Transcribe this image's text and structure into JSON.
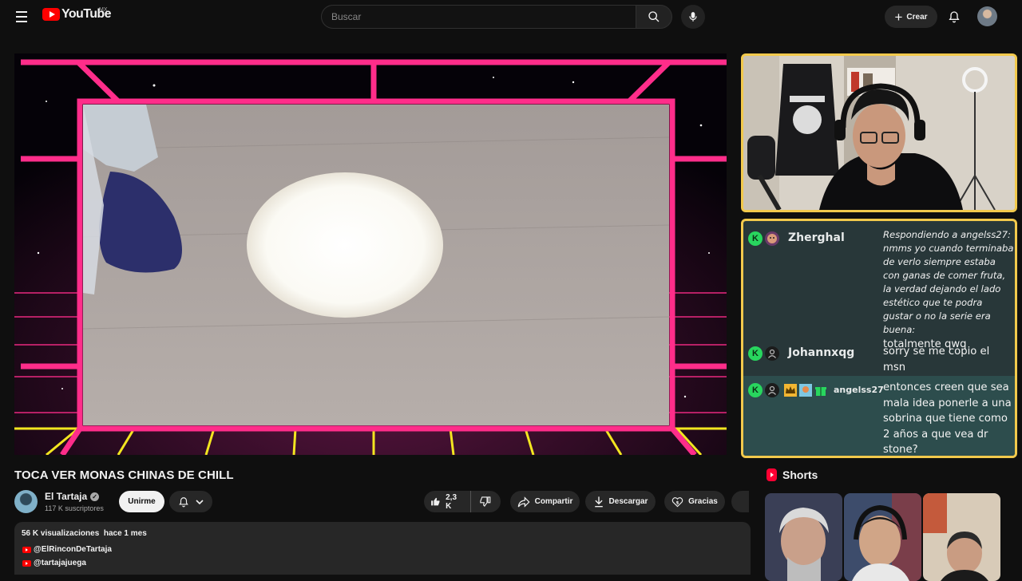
{
  "header": {
    "logo_text": "YouTube",
    "country": "MX",
    "search_placeholder": "Buscar",
    "create_label": "Crear"
  },
  "chat": {
    "messages": [
      {
        "user": "Zherghal",
        "reply_text": "Respondiendo a angelss27: nmms yo cuando terminaba de verlo siempre estaba con ganas de comer fruta, la verdad dejando el lado estético que te podra gustar o no la serie era buena:",
        "text": "totalmente qwq"
      },
      {
        "user": "Johannxqg",
        "text": "sorry se me copio el msn"
      },
      {
        "user": "angelss27",
        "text": "entonces creen que sea mala idea ponerle a una sobrina que tiene como 2 años a que vea dr stone?"
      }
    ]
  },
  "video": {
    "title": "TOCA VER MONAS CHINAS DE CHILL",
    "channel": "El Tartaja",
    "subscribers": "117 K suscriptores",
    "join_label": "Unirme",
    "likes": "2,3 K",
    "share_label": "Compartir",
    "download_label": "Descargar",
    "thanks_label": "Gracias"
  },
  "description": {
    "views": "56 K visualizaciones",
    "age": "hace 1 mes",
    "links": [
      "@ElRinconDeTartaja",
      "@tartajajuega"
    ]
  },
  "shorts": {
    "title": "Shorts"
  },
  "colors": {
    "background": "#0f0f0f",
    "accent_red": "#ff0000",
    "frame_yellow": "#f2c94c",
    "neon_pink": "#ff2d8a",
    "chat_bg": "#283739"
  }
}
